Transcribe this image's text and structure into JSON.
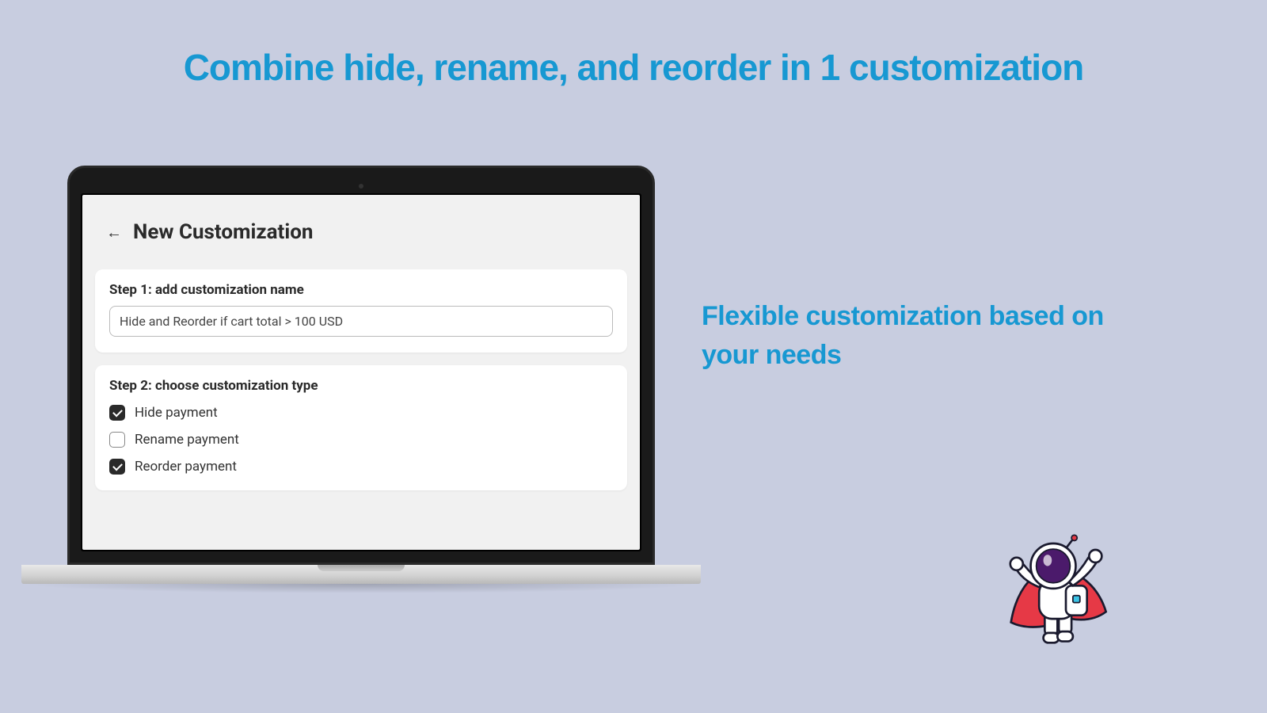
{
  "heading": "Combine hide, rename, and reorder in 1 customization",
  "subheading": "Flexible customization based on your needs",
  "screen": {
    "title": "New Customization",
    "step1": {
      "label": "Step 1: add customization name",
      "input_value": "Hide and Reorder if cart total > 100 USD"
    },
    "step2": {
      "label": "Step 2: choose customization type",
      "options": [
        {
          "label": "Hide payment",
          "checked": true
        },
        {
          "label": "Rename payment",
          "checked": false
        },
        {
          "label": "Reorder payment",
          "checked": true
        }
      ]
    }
  }
}
